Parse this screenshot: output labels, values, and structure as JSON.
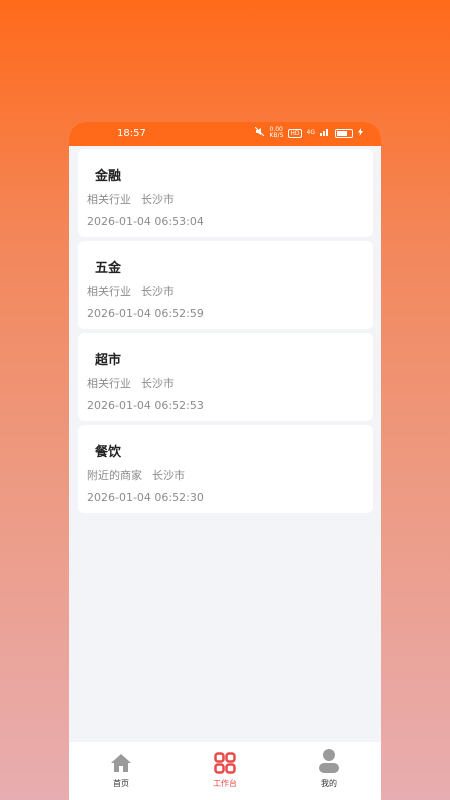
{
  "status_bar": {
    "time": "18:57",
    "net_speed": "0.00\nKB/S",
    "hd_label": "HD",
    "signal_label": "4G"
  },
  "list": [
    {
      "title": "金融",
      "category": "相关行业",
      "city": "长沙市",
      "time": "2026-01-04 06:53:04"
    },
    {
      "title": "五金",
      "category": "相关行业",
      "city": "长沙市",
      "time": "2026-01-04 06:52:59"
    },
    {
      "title": "超市",
      "category": "相关行业",
      "city": "长沙市",
      "time": "2026-01-04 06:52:53"
    },
    {
      "title": "餐饮",
      "category": "附近的商家",
      "city": "长沙市",
      "time": "2026-01-04 06:52:30"
    }
  ],
  "tabbar": {
    "home_label": "首页",
    "workbench_label": "工作台",
    "mine_label": "我的"
  },
  "colors": {
    "accent": "#ff6a1a",
    "active_tab": "#e84a4a",
    "muted_text": "#8c8c8c"
  }
}
